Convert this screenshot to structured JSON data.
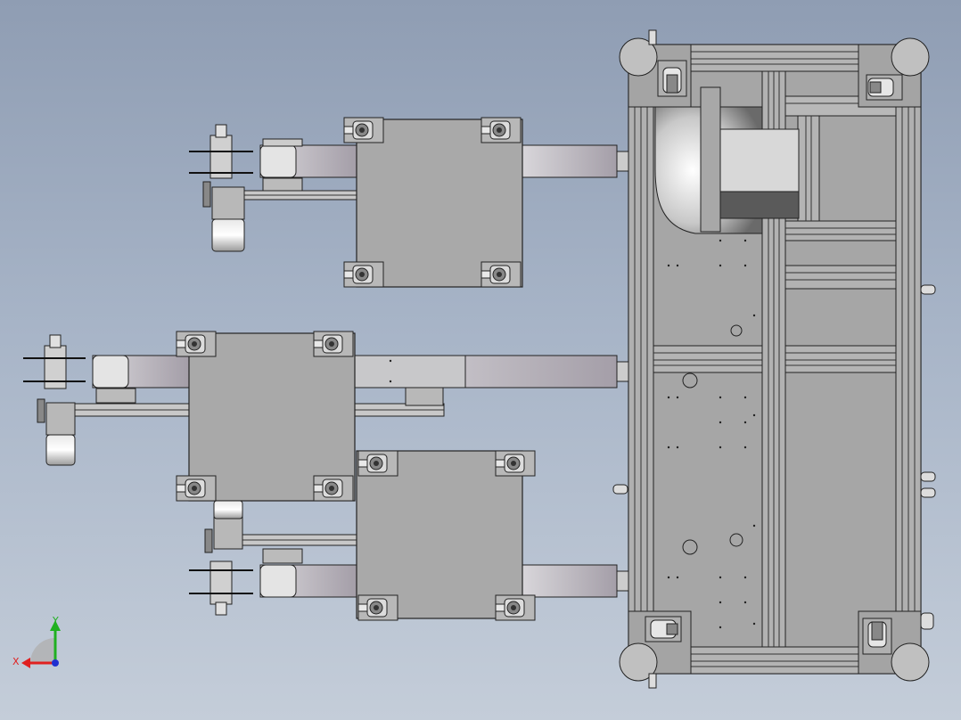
{
  "triad": {
    "x_label": "X",
    "y_label": "Y",
    "x_color": "#e02020",
    "y_color": "#20b020",
    "z_color": "#2030d0"
  },
  "colors": {
    "background_top": "#8f9db3",
    "background_bottom": "#c4cdd9",
    "panel_fill": "#a9a9a9",
    "arm_fill": "#c9c7cc",
    "outline": "#222222"
  }
}
